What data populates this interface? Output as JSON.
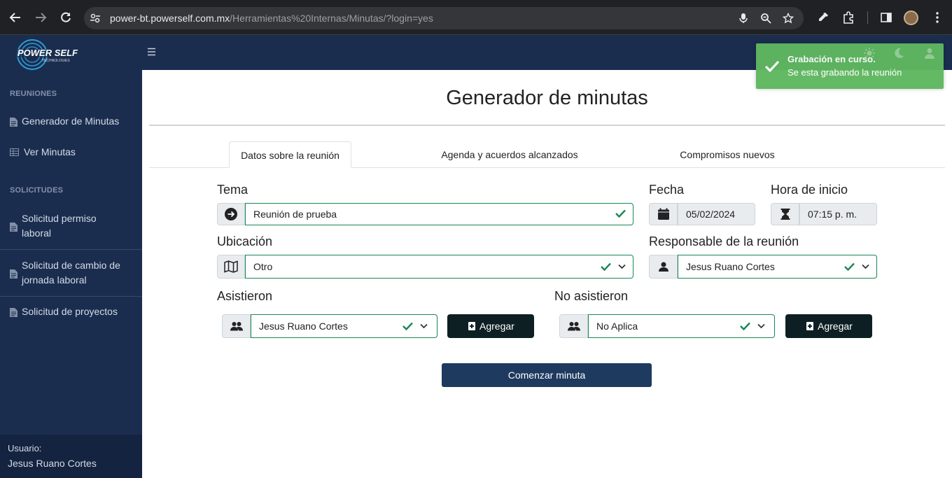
{
  "browser": {
    "url_host": "power-bt.powerself.com.mx",
    "url_path": "/Herramientas%20Internas/Minutas/?login=yes"
  },
  "sidebar": {
    "logo_text": "POWER SELF",
    "logo_sub": "TECHNOLOGIES",
    "section_reuniones": "REUNIONES",
    "section_solicitudes": "SOLICITUDES",
    "items": [
      {
        "label": "Generador de Minutas",
        "icon": "document-icon"
      },
      {
        "label": "Ver Minutas",
        "icon": "table-icon"
      },
      {
        "label": "Solicitud permiso laboral",
        "icon": "document-icon"
      },
      {
        "label": "Solicitud de cambio de jornada laboral",
        "icon": "document-icon"
      },
      {
        "label": "Solicitud de proyectos",
        "icon": "document-icon"
      }
    ],
    "user_label": "Usuario:",
    "user_name": "Jesus Ruano Cortes"
  },
  "toast": {
    "title": "Grabación en curso.",
    "message": "Se esta grabando la reunión"
  },
  "main": {
    "title": "Generador de minutas",
    "tabs": [
      {
        "label": "Datos sobre la reunión",
        "active": true
      },
      {
        "label": "Agenda y acuerdos alcanzados",
        "active": false
      },
      {
        "label": "Compromisos nuevos",
        "active": false
      }
    ],
    "form": {
      "tema_label": "Tema",
      "tema_value": "Reunión de prueba",
      "fecha_label": "Fecha",
      "fecha_value": "05/02/2024",
      "hora_label": "Hora de inicio",
      "hora_value": "07:15 p. m.",
      "ubicacion_label": "Ubicación",
      "ubicacion_value": "Otro",
      "responsable_label": "Responsable de la reunión",
      "responsable_value": "Jesus Ruano Cortes",
      "asistieron_label": "Asistieron",
      "asistieron_value": "Jesus Ruano Cortes",
      "no_asistieron_label": "No asistieron",
      "no_asistieron_value": "No Aplica",
      "agregar_label": "Agregar",
      "submit_label": "Comenzar minuta"
    }
  },
  "colors": {
    "sidebar_bg": "#1b2d4f",
    "valid_green": "#198754",
    "toast_green": "#5fb760",
    "primary_btn": "#1f3a5f",
    "add_btn": "#0e1f24"
  }
}
